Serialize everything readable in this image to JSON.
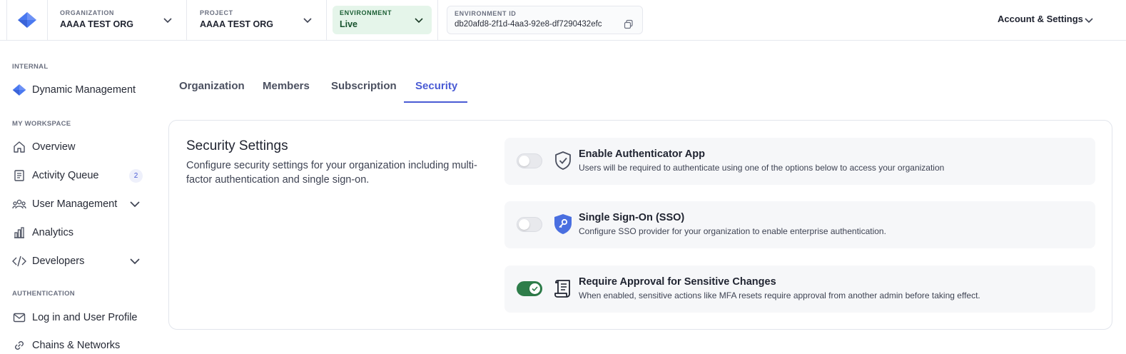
{
  "header": {
    "organization": {
      "label": "ORGANIZATION",
      "value": "AAAA TEST ORG"
    },
    "project": {
      "label": "PROJECT",
      "value": "AAAA TEST ORG"
    },
    "environment": {
      "label": "ENVIRONMENT",
      "value": "Live"
    },
    "environment_id": {
      "label": "ENVIRONMENT ID",
      "value": "db20afd8-2f1d-4aa3-92e8-df7290432efc"
    },
    "account_label": "Account & Settings"
  },
  "sidebar": {
    "internal": {
      "title": "INTERNAL",
      "items": [
        {
          "label": "Dynamic Management",
          "icon": "dynamic-logo-icon"
        }
      ]
    },
    "workspace": {
      "title": "MY WORKSPACE",
      "items": [
        {
          "label": "Overview",
          "icon": "home-icon"
        },
        {
          "label": "Activity Queue",
          "icon": "queue-icon",
          "badge": "2"
        },
        {
          "label": "User Management",
          "icon": "users-icon",
          "expandable": true
        },
        {
          "label": "Analytics",
          "icon": "bar-chart-icon"
        },
        {
          "label": "Developers",
          "icon": "code-icon",
          "expandable": true
        }
      ]
    },
    "authentication": {
      "title": "AUTHENTICATION",
      "items": [
        {
          "label": "Log in and User Profile",
          "icon": "mail-icon"
        },
        {
          "label": "Chains & Networks",
          "icon": "link-icon"
        }
      ]
    }
  },
  "tabs": [
    {
      "label": "Organization",
      "active": false
    },
    {
      "label": "Members",
      "active": false
    },
    {
      "label": "Subscription",
      "active": false
    },
    {
      "label": "Security",
      "active": true
    }
  ],
  "security": {
    "title": "Security Settings",
    "description": "Configure security settings for your organization including multi-factor authentication and single sign-on.",
    "options": [
      {
        "title": "Enable Authenticator App",
        "description": "Users will be required to authenticate using one of the options below to access your organization",
        "enabled": false,
        "icon": "shield-check-icon"
      },
      {
        "title": "Single Sign-On (SSO)",
        "description": "Configure SSO provider for your organization to enable enterprise authentication.",
        "enabled": false,
        "icon": "shield-key-icon"
      },
      {
        "title": "Require Approval for Sensitive Changes",
        "description": "When enabled, sensitive actions like MFA resets require approval from another admin before taking effect.",
        "enabled": true,
        "icon": "scroll-icon"
      }
    ]
  },
  "colors": {
    "accent": "#4a5bd4",
    "toggle_on": "#2e7d4a",
    "env_bg": "#e5f5ea"
  }
}
